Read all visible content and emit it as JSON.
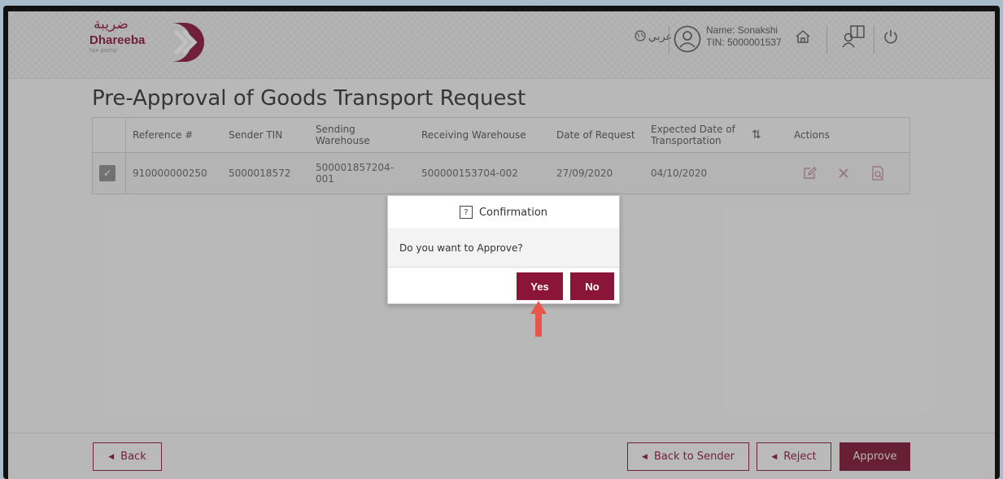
{
  "header": {
    "logo_ar": "ضريبة",
    "logo_en": "Dhareeba",
    "logo_sub": "tax portal",
    "language_label": "عربي",
    "user_name": "Name: Sonakshi",
    "user_tin": "TIN: 5000001537",
    "icons": [
      "globe-icon",
      "user-icon",
      "home-icon",
      "book-user-icon",
      "power-icon"
    ]
  },
  "page": {
    "title": "Pre-Approval of Goods Transport Request"
  },
  "table": {
    "columns": [
      "Reference #",
      "Sender TIN",
      "Sending Warehouse",
      "Receiving Warehouse",
      "Date of Request",
      "Expected Date of Transportation",
      "Actions"
    ],
    "rows": [
      {
        "checked": true,
        "reference": "910000000250",
        "sender_tin": "5000018572",
        "sending_warehouse": "500001857204-001",
        "receiving_warehouse": "500000153704-002",
        "date_of_request": "27/09/2020",
        "expected_date": "04/10/2020"
      }
    ]
  },
  "footer": {
    "back_label": "Back",
    "back_to_sender_label": "Back to Sender",
    "reject_label": "Reject",
    "approve_label": "Approve"
  },
  "modal": {
    "title": "Confirmation",
    "message": "Do you want to Approve?",
    "yes_label": "Yes",
    "no_label": "No"
  },
  "colors": {
    "brand": "#8a1538",
    "annotation_arrow": "#e8554a"
  }
}
